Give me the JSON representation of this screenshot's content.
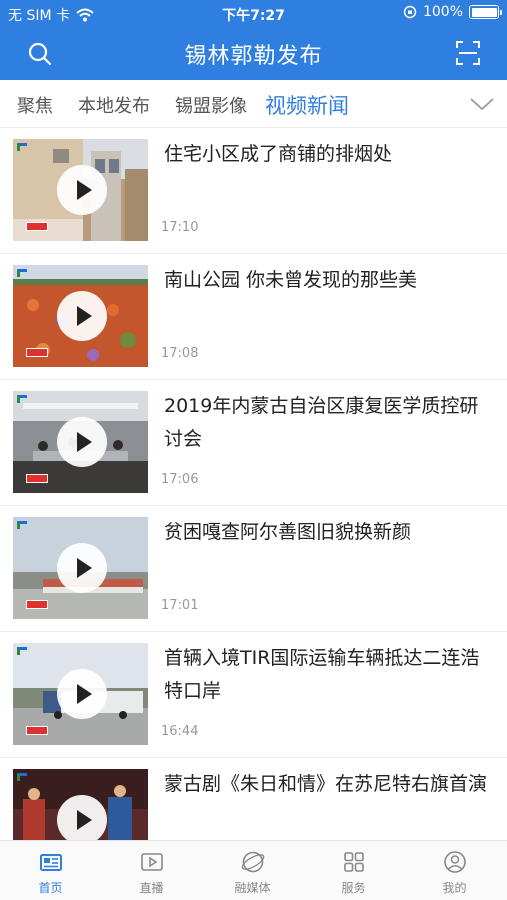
{
  "status_bar": {
    "carrier": "无 SIM 卡",
    "time": "下午7:27",
    "battery": "100%",
    "battery_level": 1.0
  },
  "header": {
    "title": "锡林郭勒发布"
  },
  "tabs": [
    {
      "label": "聚焦",
      "active": false
    },
    {
      "label": "本地发布",
      "active": false
    },
    {
      "label": "锡盟影像",
      "active": false
    },
    {
      "label": "视频新闻",
      "active": true
    }
  ],
  "news": [
    {
      "title": "住宅小区成了商铺的排烟处",
      "time": "17:10",
      "thumb": "building-facade"
    },
    {
      "title": "南山公园 你未曾发现的那些美",
      "time": "17:08",
      "thumb": "flower-field"
    },
    {
      "title": "2019年内蒙古自治区康复医学质控研讨会",
      "time": "17:06",
      "thumb": "conference-room"
    },
    {
      "title": "贫困嘎查阿尔善图旧貌换新颜",
      "time": "17:01",
      "thumb": "grassland-village"
    },
    {
      "title": "首辆入境TIR国际运输车辆抵达二连浩特口岸",
      "time": "16:44",
      "thumb": "truck-road"
    },
    {
      "title": "蒙古剧《朱日和情》在苏尼特右旗首演",
      "time": "",
      "thumb": "stage-performance"
    }
  ],
  "bottom_nav": [
    {
      "label": "首页",
      "icon": "news-home-icon",
      "active": true
    },
    {
      "label": "直播",
      "icon": "live-play-icon",
      "active": false
    },
    {
      "label": "融媒体",
      "icon": "media-globe-icon",
      "active": false
    },
    {
      "label": "服务",
      "icon": "services-grid-icon",
      "active": false
    },
    {
      "label": "我的",
      "icon": "profile-icon",
      "active": false
    }
  ],
  "colors": {
    "brand": "#2f7fe0",
    "text": "#222222",
    "muted": "#999999"
  }
}
